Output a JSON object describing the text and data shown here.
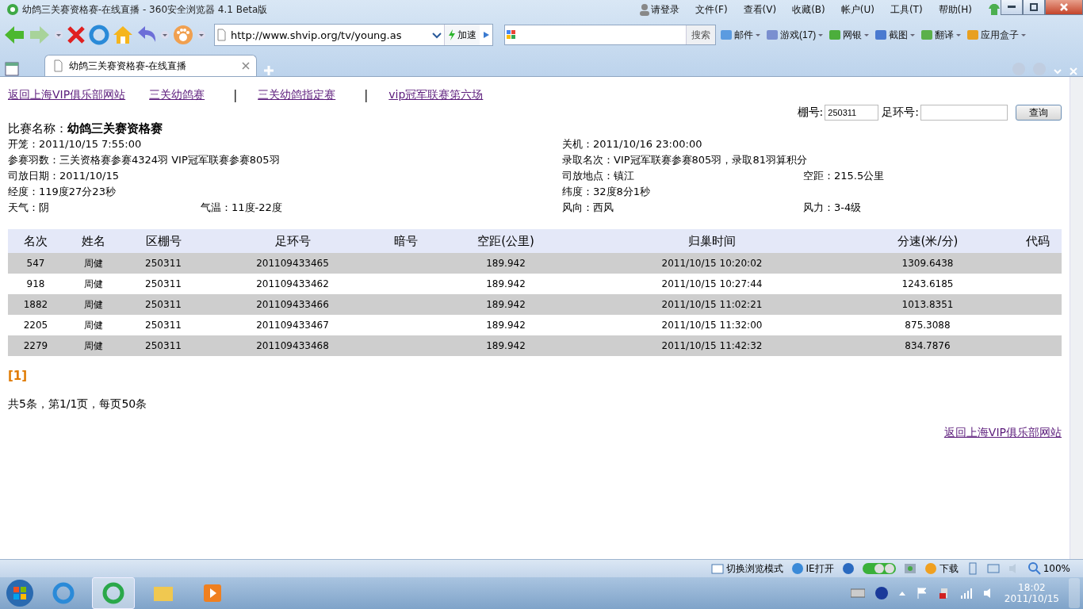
{
  "window": {
    "title": "幼鸽三关赛资格赛-在线直播 - 360安全浏览器 4.1 Beta版"
  },
  "menu": [
    "请登录",
    "文件(F)",
    "查看(V)",
    "收藏(B)",
    "帐户(U)",
    "工具(T)",
    "帮助(H)"
  ],
  "address": {
    "value": "http://www.shvip.org/tv/young.as",
    "speed": "加速"
  },
  "search": {
    "button": "搜索"
  },
  "toolbar_items": [
    "邮件",
    "游戏(17)",
    "网银",
    "截图",
    "翻译",
    "应用盒子"
  ],
  "tabs": [
    {
      "label": "幼鸽三关赛资格赛-在线直播",
      "selected": true
    }
  ],
  "nav": [
    {
      "kind": "link",
      "text": "返回上海VIP俱乐部网站"
    },
    {
      "kind": "link",
      "text": "三关幼鸽赛"
    },
    {
      "kind": "separator",
      "text": "|"
    },
    {
      "kind": "link",
      "text": "三关幼鸽指定赛"
    },
    {
      "kind": "separator",
      "text": "|"
    },
    {
      "kind": "link",
      "text": "vip冠军联赛第六场"
    }
  ],
  "query": {
    "pen_label": "棚号:",
    "pen_value": "250311",
    "ring_label": "足环号:",
    "button": "查询"
  },
  "race_name": "比赛名称：**幼鸽三关赛资格赛**",
  "info_rows": [
    {
      "left": [
        "开笼：2011/10/15 7:55:00"
      ],
      "right": [
        "关机：2011/10/16 23:00:00"
      ]
    },
    {
      "left": [
        "参赛羽数：三关资格赛参赛4324羽 VIP冠军联赛参赛805羽"
      ],
      "right": [
        "录取名次：VIP冠军联赛参赛805羽，录取81羽算积分"
      ]
    },
    {
      "left": [
        "司放日期：2011/10/15"
      ],
      "right": [
        "司放地点：镇江",
        "空距：215.5公里"
      ]
    },
    {
      "left": [
        "经度：119度27分23秒"
      ],
      "right": [
        "纬度：32度8分1秒"
      ]
    },
    {
      "left": [
        "天气：阴",
        "气温：11度-22度"
      ],
      "right": [
        "风向：西风",
        "风力：3-4级"
      ]
    }
  ],
  "table": {
    "columns": [
      "名次",
      "姓名",
      "区棚号",
      "足环号",
      "暗号",
      "空距(公里)",
      "归巢时间",
      "分速(米/分)",
      "代码"
    ],
    "rows": [
      [
        "547",
        "周健",
        "250311",
        "201109433465",
        "",
        "189.942",
        "2011/10/15 10:20:02",
        "1309.6438",
        ""
      ],
      [
        "918",
        "周健",
        "250311",
        "201109433462",
        "",
        "189.942",
        "2011/10/15 10:27:44",
        "1243.6185",
        ""
      ],
      [
        "1882",
        "周健",
        "250311",
        "201109433466",
        "",
        "189.942",
        "2011/10/15 11:02:21",
        "1013.8351",
        ""
      ],
      [
        "2205",
        "周健",
        "250311",
        "201109433467",
        "",
        "189.942",
        "2011/10/15 11:32:00",
        "875.3088",
        ""
      ],
      [
        "2279",
        "周健",
        "250311",
        "201109433468",
        "",
        "189.942",
        "2011/10/15 11:42:32",
        "834.7876",
        ""
      ]
    ]
  },
  "pager": "[1]",
  "summary": "共5条，第1/1页，每页50条",
  "bottom_link": "返回上海VIP俱乐部网站",
  "status_bar": {
    "mode": "切换浏览模式",
    "ie": "IE打开",
    "download": "下载",
    "zoom": "100%"
  },
  "taskbar": {
    "time": "18:02",
    "date": "2011/10/15"
  }
}
